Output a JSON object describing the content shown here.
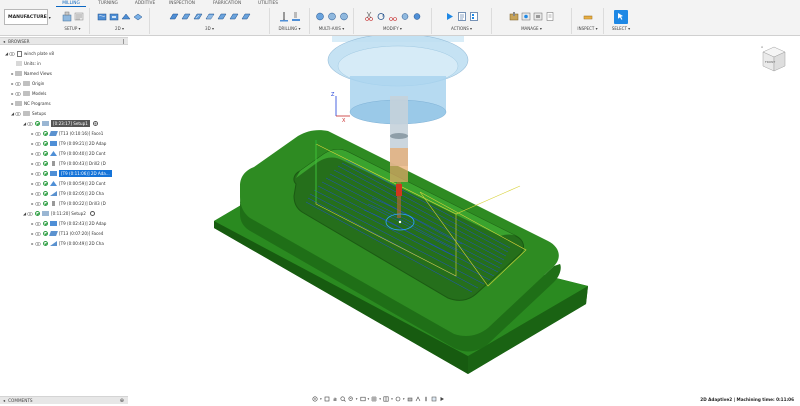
{
  "workspace": {
    "label": "MANUFACTURE"
  },
  "tabs": [
    "MILLING",
    "TURNING",
    "ADDITIVE",
    "INSPECTION",
    "FABRICATION",
    "UTILITIES"
  ],
  "groups": [
    {
      "label": "SETUP ▾"
    },
    {
      "label": "2D ▾"
    },
    {
      "label": "3D ▾"
    },
    {
      "label": "DRILLING ▾"
    },
    {
      "label": "MULTI-AXIS ▾"
    },
    {
      "label": "MODIFY ▾"
    },
    {
      "label": "ACTIONS ▾"
    },
    {
      "label": "MANAGE ▾"
    },
    {
      "label": "INSPECT ▾"
    },
    {
      "label": "SELECT ▾"
    }
  ],
  "browser": {
    "title": "BROWSER",
    "rows": [
      {
        "label": "winch plate v8"
      },
      {
        "label": "Units: in"
      },
      {
        "label": "Named Views"
      },
      {
        "label": "Origin"
      },
      {
        "label": "Models"
      },
      {
        "label": "NC Programs"
      },
      {
        "label": "Setups"
      },
      {
        "label": "[0:23:17] Setup1"
      },
      {
        "label": "[T13 (0:10:16)] Face1"
      },
      {
        "label": "[T9 (0:09:21)] 2D Adap"
      },
      {
        "label": "[T9 (0:00:40)] 2D Cont"
      },
      {
        "label": "[T9 (0:00:43)] Drill2 (D"
      },
      {
        "label": "[T9 (0:11:06)] 2D Ada..."
      },
      {
        "label": "[T9 (0:00:59)] 2D Cont"
      },
      {
        "label": "[T9 (0:02:05)] 2D Cha"
      },
      {
        "label": "[T9 (0:00:22)] Drill3 (D"
      },
      {
        "label": "[0:11:20] Setup2"
      },
      {
        "label": "[T9 (0:02:43)] 2D Adap"
      },
      {
        "label": "[T13 (0:07:20)] Face4"
      },
      {
        "label": "[T9 (0:00:49)] 2D Cha"
      }
    ]
  },
  "comments": {
    "title": "COMMENTS"
  },
  "status": {
    "text": "2D Adaptive2 | Machining time: 0:11:06"
  },
  "colors": {
    "accent": "#1473d8",
    "part_green": "#2e8b22",
    "part_dark": "#1d6a15",
    "toolpath_blue": "#1f4fd1",
    "tool_ghost": "#a9d3ee"
  },
  "viewcube": {
    "face": "FRONT"
  }
}
